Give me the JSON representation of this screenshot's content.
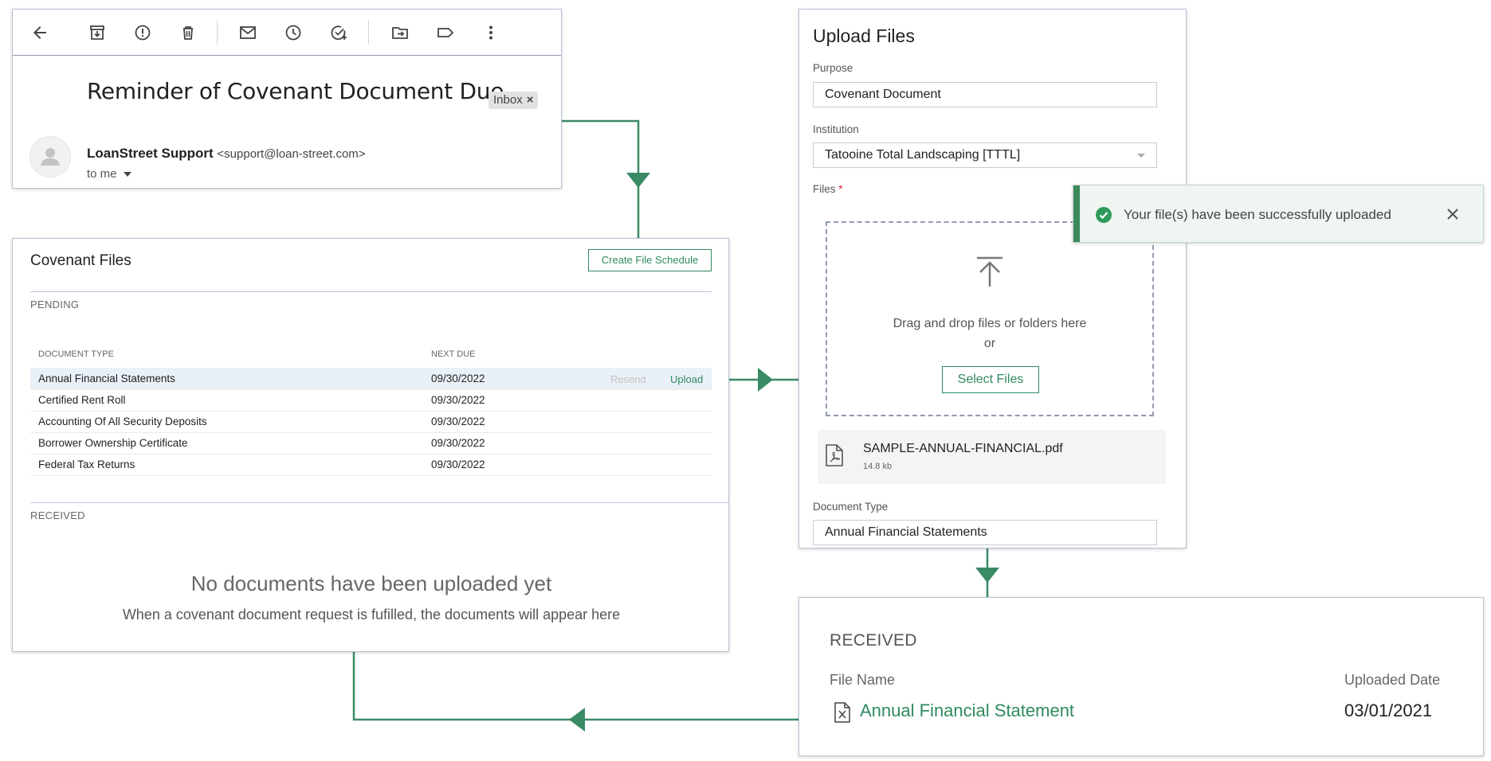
{
  "email": {
    "subject": "Reminder of Covenant Document Due",
    "inbox_label": "Inbox",
    "chip_close": "×",
    "sender_name": "LoanStreet Support",
    "sender_email": "<support@loan-street.com>",
    "recipient": "to me"
  },
  "toolbar_icons": [
    "back-arrow-icon",
    "archive-icon",
    "report-spam-icon",
    "delete-icon",
    "mail-icon",
    "snooze-clock-icon",
    "add-task-icon",
    "move-to-icon",
    "label-icon",
    "more-vert-icon"
  ],
  "covenant": {
    "title": "Covenant Files",
    "create_button": "Create File Schedule",
    "pending_label": "PENDING",
    "columns": {
      "doc_type": "DOCUMENT TYPE",
      "next_due": "NEXT DUE"
    },
    "rows": [
      {
        "doc_type": "Annual Financial Statements",
        "next_due": "09/30/2022",
        "resend": "Resend",
        "upload": "Upload"
      },
      {
        "doc_type": "Certified Rent Roll",
        "next_due": "09/30/2022"
      },
      {
        "doc_type": "Accounting Of All Security Deposits",
        "next_due": "09/30/2022"
      },
      {
        "doc_type": "Borrower Ownership Certificate",
        "next_due": "09/30/2022"
      },
      {
        "doc_type": "Federal Tax Returns",
        "next_due": "09/30/2022"
      }
    ],
    "received_label": "RECEIVED",
    "empty_title": "No documents have been uploaded yet",
    "empty_subtitle": "When a covenant document request is fufilled, the documents will appear here"
  },
  "upload": {
    "title": "Upload Files",
    "purpose_label": "Purpose",
    "purpose_value": "Covenant Document",
    "institution_label": "Institution",
    "institution_value": "Tatooine Total Landscaping [TTTL]",
    "files_label": "Files",
    "required_mark": "*",
    "drop_text": "Drag and drop files or folders here",
    "or_text": "or",
    "select_button": "Select Files",
    "file_name": "SAMPLE-ANNUAL-FINANCIAL.pdf",
    "file_size": "14.8 kb",
    "doctype_label": "Document Type",
    "doctype_value": "Annual Financial Statements"
  },
  "toast": {
    "message": "Your file(s) have been successfully uploaded"
  },
  "received": {
    "title": "RECEIVED",
    "col_file": "File Name",
    "col_date": "Uploaded Date",
    "file_name": "Annual Financial Statement",
    "uploaded_date": "03/01/2021"
  },
  "colors": {
    "accent_green": "#2f8a5e",
    "flow_line": "#3a8a66",
    "border_blue_gray": "#b9c3d6",
    "row_highlight": "#eaf0f7",
    "toast_bg": "#eff5f0"
  }
}
